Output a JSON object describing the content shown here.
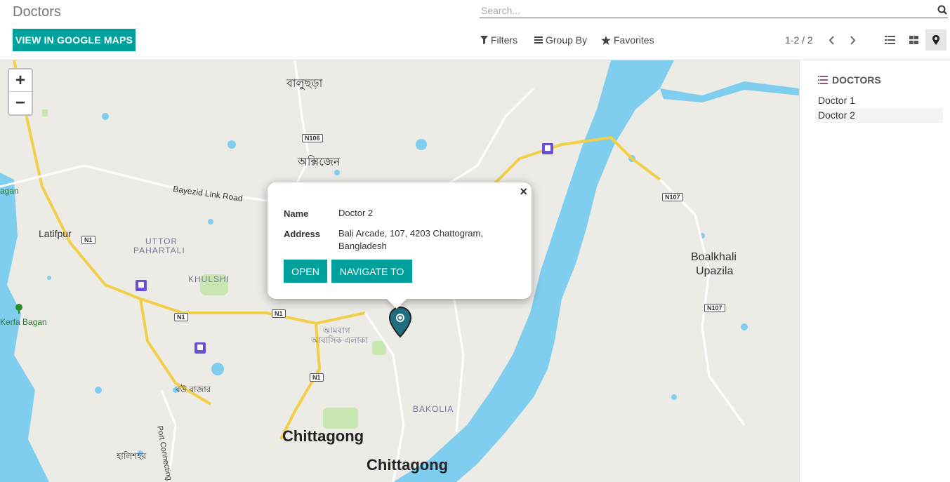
{
  "header": {
    "breadcrumb": "Doctors",
    "search_placeholder": "Search...",
    "google_maps_button": "VIEW IN GOOGLE MAPS",
    "filters_label": "Filters",
    "groupby_label": "Group By",
    "favorites_label": "Favorites",
    "pager": "1-2 / 2"
  },
  "map": {
    "labels": [
      "বালুছড়া",
      "অক্সিজেন",
      "Bayezid Link Road",
      "Latifpur",
      "UTTOR",
      "PAHARTALI",
      "KHULSHI",
      "Kerfa Bagan",
      "agan",
      "আমবাগ",
      "আবাসিক এলাকা",
      "বউ বাজার",
      "Port Connecting",
      "হালিশহর",
      "BAKOLIA",
      "Chittagong",
      "Chittagong",
      "Boalkhali",
      "Upazila"
    ],
    "shields": [
      "N106",
      "N1",
      "N1",
      "N1",
      "N1",
      "N107",
      "N107"
    ],
    "popup": {
      "name_label": "Name",
      "name_value": "Doctor 2",
      "address_label": "Address",
      "address_value": "Bali Arcade, 107, 4203 Chattogram, Bangladesh",
      "open_button": "OPEN",
      "navigate_button": "NAVIGATE TO",
      "close_symbol": "×"
    },
    "zoom_in": "+",
    "zoom_out": "−",
    "marker_color": "#1f6f80"
  },
  "sidebar": {
    "title": "DOCTORS",
    "items": [
      "Doctor 1",
      "Doctor 2"
    ]
  },
  "colors": {
    "primary": "#00a09d",
    "water": "#7fcdef",
    "road_major": "#f3d34a"
  }
}
